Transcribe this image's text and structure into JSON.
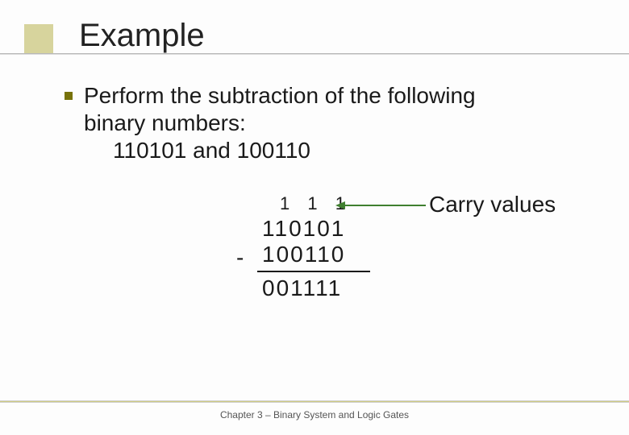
{
  "title": "Example",
  "bullet": {
    "line1": "Perform the subtraction of the following",
    "line2": "binary numbers:",
    "line3": "110101  and  100110"
  },
  "math": {
    "carry": "1 1 1",
    "operand1": "110101",
    "operand2": "100110",
    "operator": "-",
    "result": "001111"
  },
  "carry_label": "Carry values",
  "footer": "Chapter 3 – Binary  System and Logic Gates"
}
